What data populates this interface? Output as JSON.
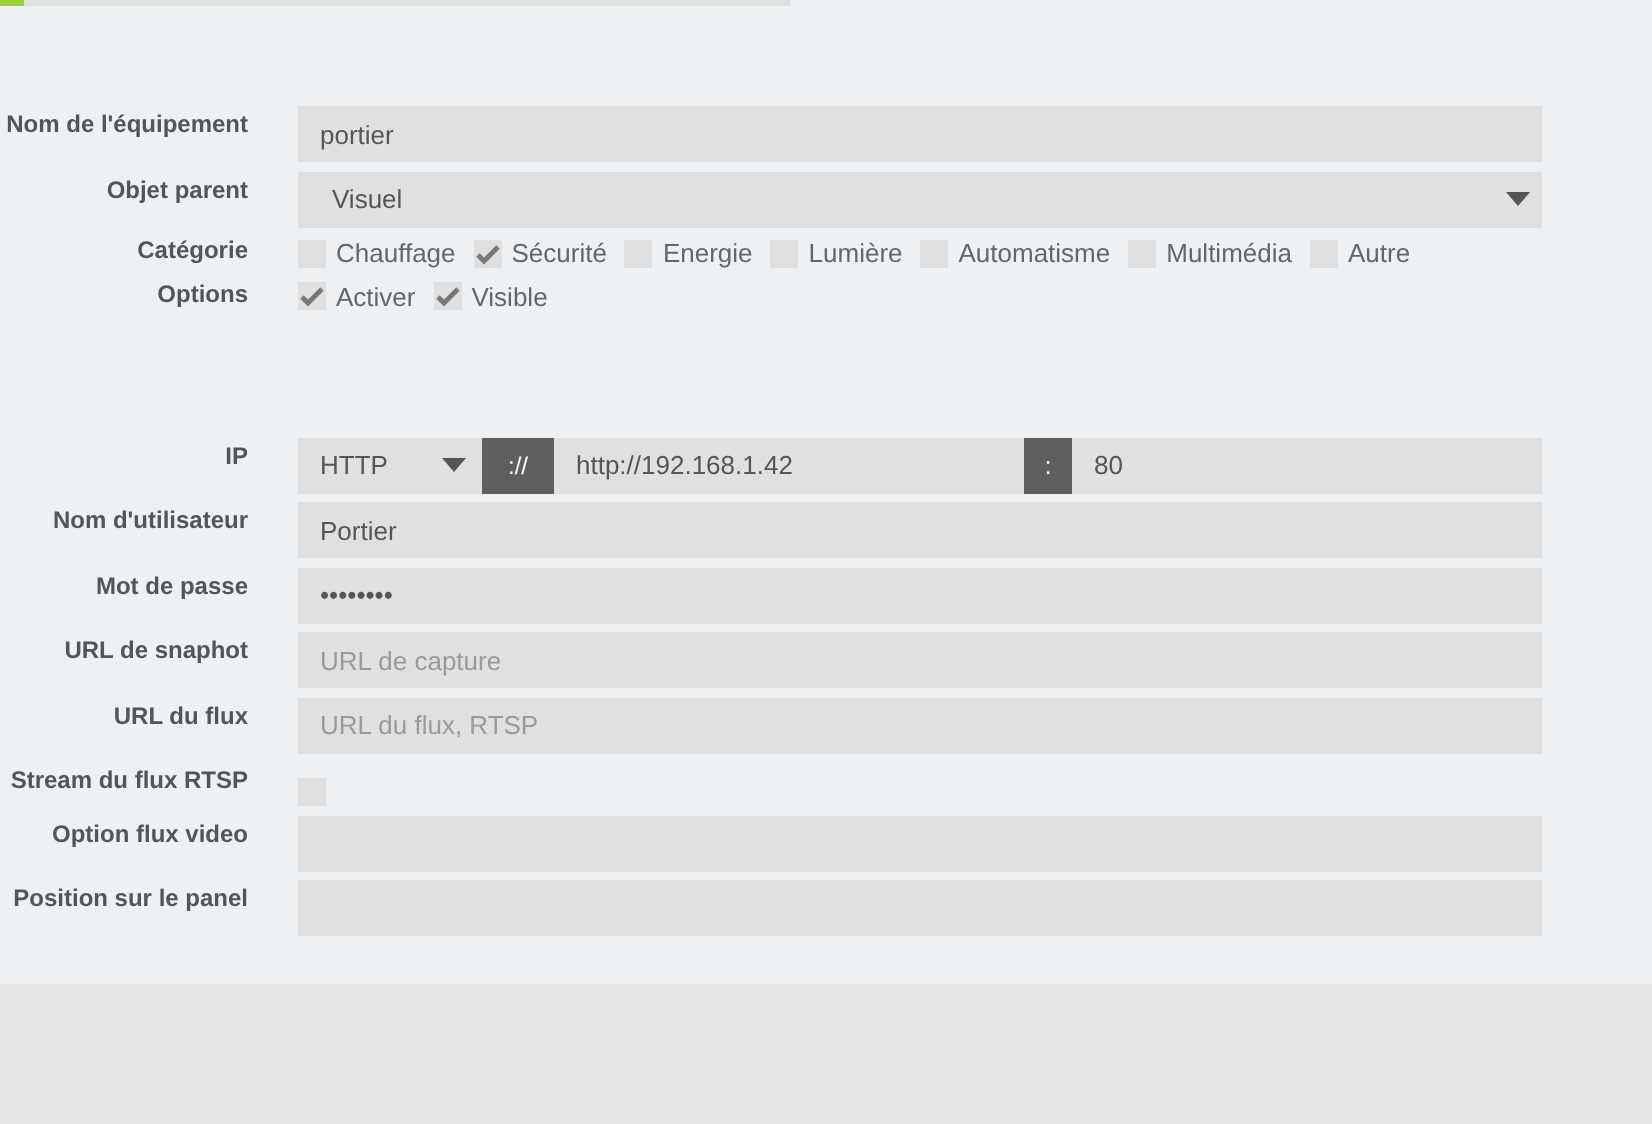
{
  "progress": {
    "level": 0.03
  },
  "sections": [
    {
      "rows": [
        {
          "kind": "text",
          "label": "Nom de l'équipement",
          "value": "portier"
        },
        {
          "kind": "select",
          "label": "Objet parent",
          "value": "Visuel"
        },
        {
          "kind": "checks",
          "label": "Catégorie",
          "options": [
            {
              "label": "Chauffage",
              "checked": false
            },
            {
              "label": "Sécurité",
              "checked": true
            },
            {
              "label": "Energie",
              "checked": false
            },
            {
              "label": "Lumière",
              "checked": false
            },
            {
              "label": "Automatisme",
              "checked": false
            },
            {
              "label": "Multimédia",
              "checked": false
            },
            {
              "label": "Autre",
              "checked": false
            }
          ]
        },
        {
          "kind": "checks",
          "label": "Options",
          "options": [
            {
              "label": "Activer",
              "checked": true
            },
            {
              "label": "Visible",
              "checked": true
            }
          ]
        }
      ]
    },
    {
      "rows": [
        {
          "kind": "ip",
          "label": "IP",
          "protocol": "HTTP",
          "separator": "://",
          "value": "http://192.168.1.42",
          "port_separator": ":",
          "port": "80"
        },
        {
          "kind": "text",
          "label": "Nom d'utilisateur",
          "value": "Portier"
        },
        {
          "kind": "text",
          "label": "Mot de passe",
          "value": "••••••••"
        },
        {
          "kind": "text",
          "label": "URL de snaphot",
          "placeholder": "URL de capture"
        },
        {
          "kind": "text",
          "label": "URL du flux",
          "placeholder": "URL du flux, RTSP"
        },
        {
          "kind": "check",
          "label": "Stream du flux RTSP",
          "checked": false
        },
        {
          "kind": "text",
          "label": "Option flux video"
        },
        {
          "kind": "text",
          "label": "Position sur le panel"
        }
      ]
    }
  ]
}
